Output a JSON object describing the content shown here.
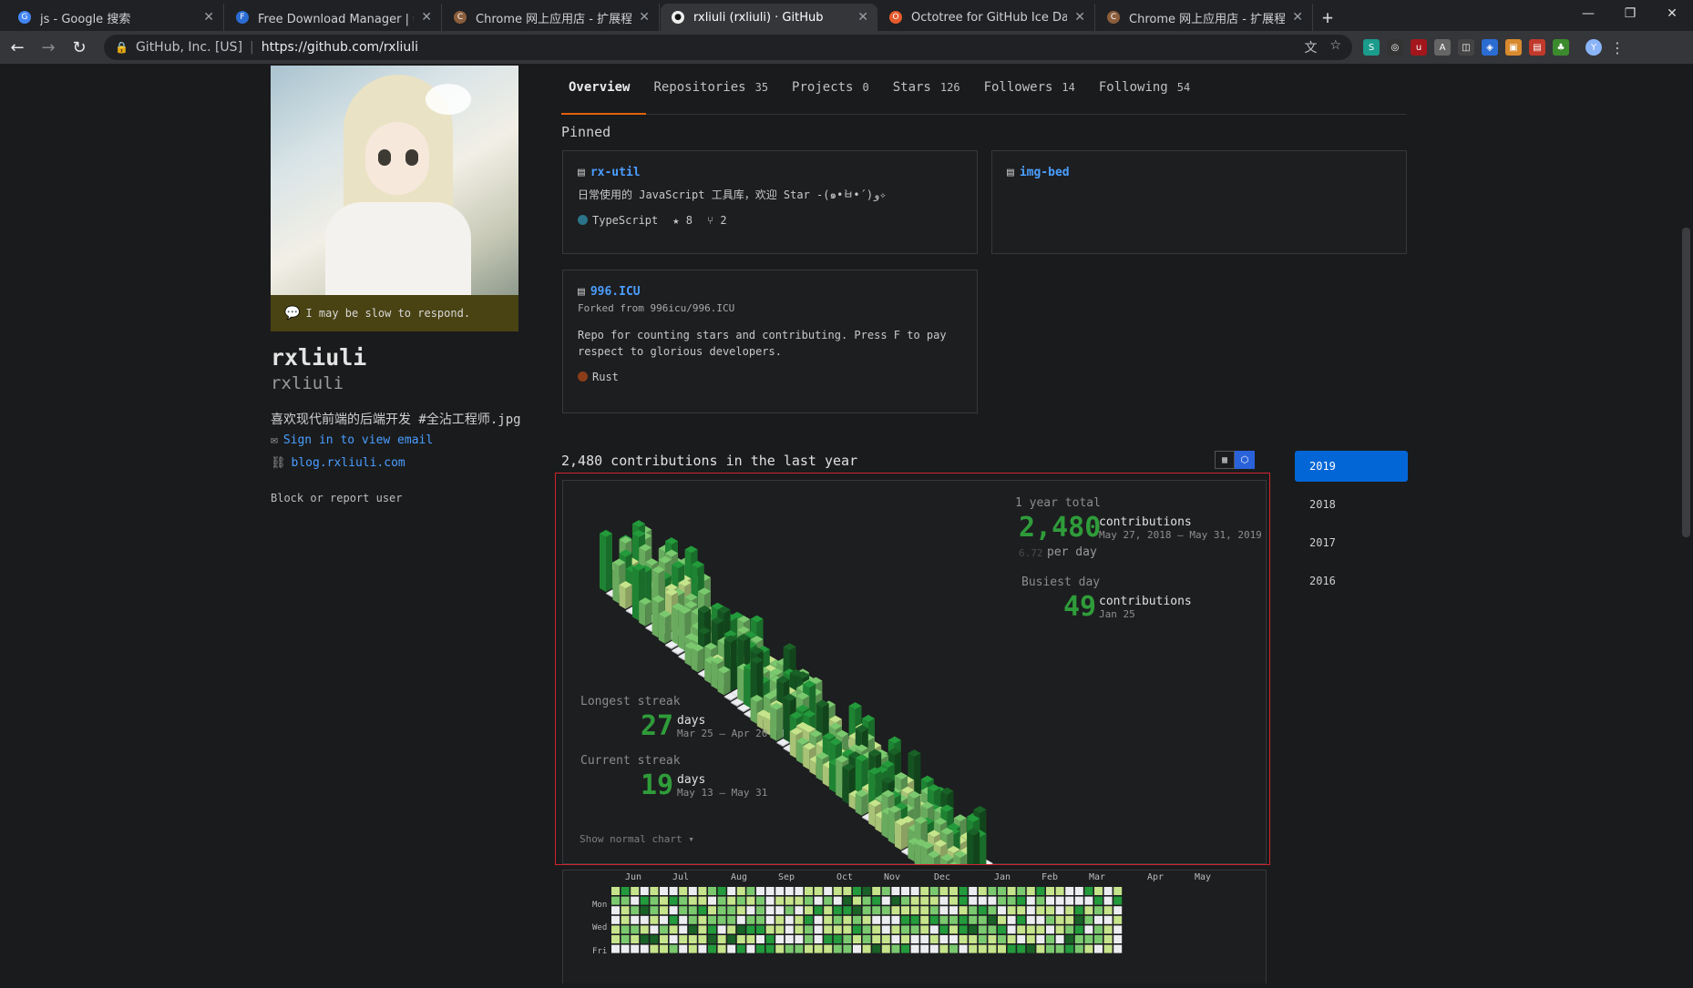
{
  "browser": {
    "tabs": [
      {
        "title": "js - Google 搜索",
        "fav": "G",
        "favColor": "#4285f4"
      },
      {
        "title": "Free Download Manager | 特色",
        "fav": "F",
        "favColor": "#2b6cd3"
      },
      {
        "title": "Chrome 网上应用店 - 扩展程序",
        "fav": "C",
        "favColor": "#8b5e3c"
      },
      {
        "title": "rxliuli (rxliuli) · GitHub",
        "fav": "●",
        "favColor": "#eeeeee",
        "active": true
      },
      {
        "title": "Octotree for GitHub Ice Dark",
        "fav": "O",
        "favColor": "#e65b2e"
      },
      {
        "title": "Chrome 网上应用店 - 扩展程序",
        "fav": "C",
        "favColor": "#8b5e3c"
      }
    ],
    "new_tab": "+",
    "org": "GitHub, Inc. [US]",
    "url": "https://github.com/rxliuli"
  },
  "profile": {
    "status": "I may be slow to respond.",
    "name": "rxliuli",
    "login": "rxliuli",
    "bio": "喜欢现代前端的后端开发 #全沾工程师.jpg",
    "email": "Sign in to view email",
    "blog": "blog.rxliuli.com",
    "block": "Block or report user"
  },
  "nav": [
    {
      "label": "Overview",
      "count": "",
      "active": true
    },
    {
      "label": "Repositories",
      "count": "35"
    },
    {
      "label": "Projects",
      "count": "0"
    },
    {
      "label": "Stars",
      "count": "126"
    },
    {
      "label": "Followers",
      "count": "14"
    },
    {
      "label": "Following",
      "count": "54"
    }
  ],
  "pinned": {
    "heading": "Pinned",
    "cards": [
      {
        "name": "rx-util",
        "desc": "日常使用的 JavaScript 工具库，欢迎 Star -(๑•̀ㅂ•́)و✧",
        "lang": "TypeScript",
        "langColor": "#2b7489",
        "stars": "8",
        "forks": "2"
      },
      {
        "name": "img-bed"
      },
      {
        "name": "996.ICU",
        "fork": "Forked from 996icu/996.ICU",
        "desc": "Repo for counting stars and contributing. Press F to pay respect to glorious developers.",
        "lang": "Rust",
        "langColor": "#8b3d1a"
      }
    ]
  },
  "contrib": {
    "heading": "2,480 contributions in the last year",
    "years": [
      "2019",
      "2018",
      "2017",
      "2016"
    ],
    "total_label": "1 year total",
    "total": "2,480",
    "total_unit": "contributions",
    "total_range": "May 27, 2018 – May 31, 2019",
    "per_day_value": "6.72",
    "per_day": "per day",
    "busiest_label": "Busiest day",
    "busiest": "49",
    "busiest_unit": "contributions",
    "busiest_date": "Jan 25",
    "longest_label": "Longest streak",
    "longest": "27",
    "longest_unit": "days",
    "longest_range": "Mar 25 – Apr 20",
    "current_label": "Current streak",
    "current": "19",
    "current_unit": "days",
    "current_range": "May 13 – May 31",
    "show_normal": "Show normal chart ▾",
    "months": [
      "Jun",
      "Jul",
      "Aug",
      "Sep",
      "Oct",
      "Nov",
      "Dec",
      "Jan",
      "Feb",
      "Mar",
      "Apr",
      "May"
    ],
    "days": [
      "Mon",
      "Wed",
      "Fri"
    ]
  },
  "colors": {
    "accent": "#0366d6",
    "green": "#2f9c3a",
    "link": "#4a9eff"
  }
}
